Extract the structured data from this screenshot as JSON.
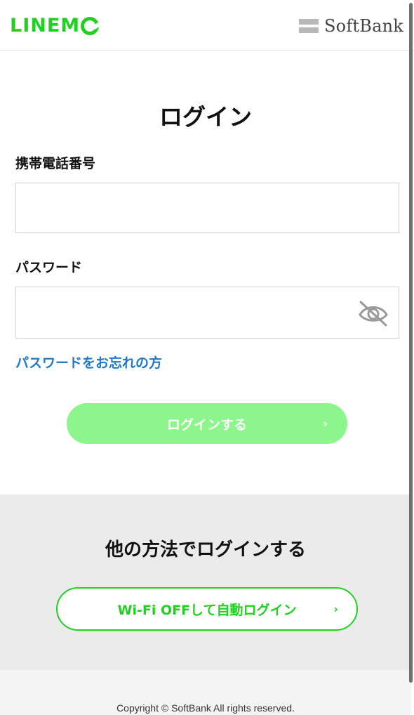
{
  "header": {
    "brand_left": "LINEM",
    "brand_right": "SoftBank"
  },
  "login": {
    "title": "ログイン",
    "phone_label": "携帯電話番号",
    "phone_value": "",
    "password_label": "パスワード",
    "password_value": "",
    "eye_icon": "eye-off-icon",
    "forgot_link": "パスワードをお忘れの方",
    "submit_label": "ログインする",
    "submit_chevron": "›",
    "submit_color": "#8cf58c"
  },
  "alternative": {
    "title": "他の方法でログインする",
    "wifi_button_label": "Wi-Fi OFFして自動ログイン",
    "wifi_button_chevron": "›",
    "accent_color": "#21d021"
  },
  "footer": {
    "copyright": "Copyright © SoftBank All rights reserved."
  },
  "colors": {
    "brand_green": "#21d021",
    "link_blue": "#1f78c8",
    "alt_background": "#ebebeb"
  }
}
